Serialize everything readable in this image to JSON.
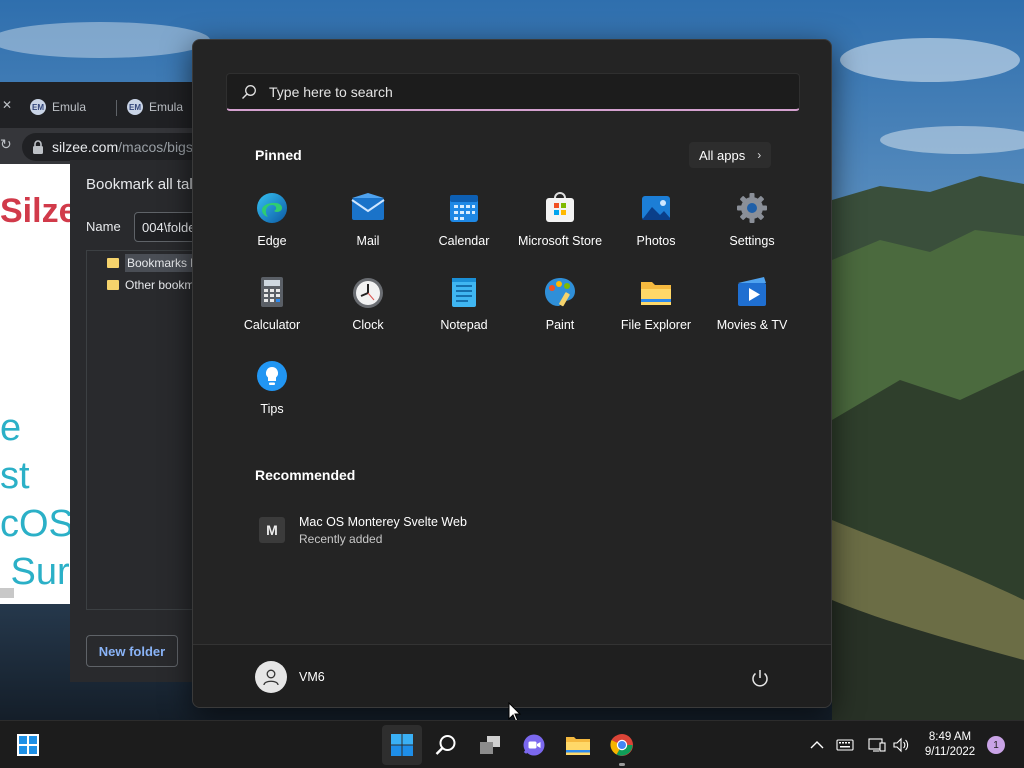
{
  "browser": {
    "tabs": [
      {
        "title": "Emula"
      },
      {
        "title": "Emula"
      }
    ],
    "tab_favicon": "EM",
    "address": {
      "host": "silzee.com",
      "path": "/macos/bigs"
    },
    "page": {
      "brand": "Silze",
      "hero": "e\nst\ncOS\n Sur"
    }
  },
  "bookmark_dialog": {
    "title": "Bookmark all tal",
    "name_label": "Name",
    "name_value": "004\\folde",
    "folders": [
      "Bookmarks l",
      "Other bookm"
    ],
    "new_folder_label": "New folder"
  },
  "start_menu": {
    "search_placeholder": "Type here to search",
    "pinned_title": "Pinned",
    "all_apps_label": "All apps",
    "pinned_apps": [
      {
        "label": "Edge",
        "icon": "edge-icon"
      },
      {
        "label": "Mail",
        "icon": "mail-icon"
      },
      {
        "label": "Calendar",
        "icon": "calendar-icon"
      },
      {
        "label": "Microsoft Store",
        "icon": "store-icon"
      },
      {
        "label": "Photos",
        "icon": "photos-icon"
      },
      {
        "label": "Settings",
        "icon": "settings-icon"
      },
      {
        "label": "Calculator",
        "icon": "calculator-icon"
      },
      {
        "label": "Clock",
        "icon": "clock-icon"
      },
      {
        "label": "Notepad",
        "icon": "notepad-icon"
      },
      {
        "label": "Paint",
        "icon": "paint-icon"
      },
      {
        "label": "File Explorer",
        "icon": "file-explorer-icon"
      },
      {
        "label": "Movies & TV",
        "icon": "movies-tv-icon"
      },
      {
        "label": "Tips",
        "icon": "tips-icon"
      }
    ],
    "recommended_title": "Recommended",
    "recommended": [
      {
        "title": "Mac OS Monterey Svelte Web",
        "subtitle": "Recently added",
        "icon_letter": "M"
      }
    ],
    "user_name": "VM6"
  },
  "taskbar": {
    "apps": [
      "start-icon",
      "search-icon",
      "task-view-icon",
      "teams-chat-icon",
      "file-explorer-icon",
      "chrome-icon"
    ],
    "clock_time": "8:49 AM",
    "clock_date": "9/11/2022",
    "notification_count": "1"
  },
  "colors": {
    "start_bg": "#242424",
    "taskbar_bg": "#1c1c1c",
    "accent": "#0078d4",
    "search_underline": "#d4a1cf"
  }
}
